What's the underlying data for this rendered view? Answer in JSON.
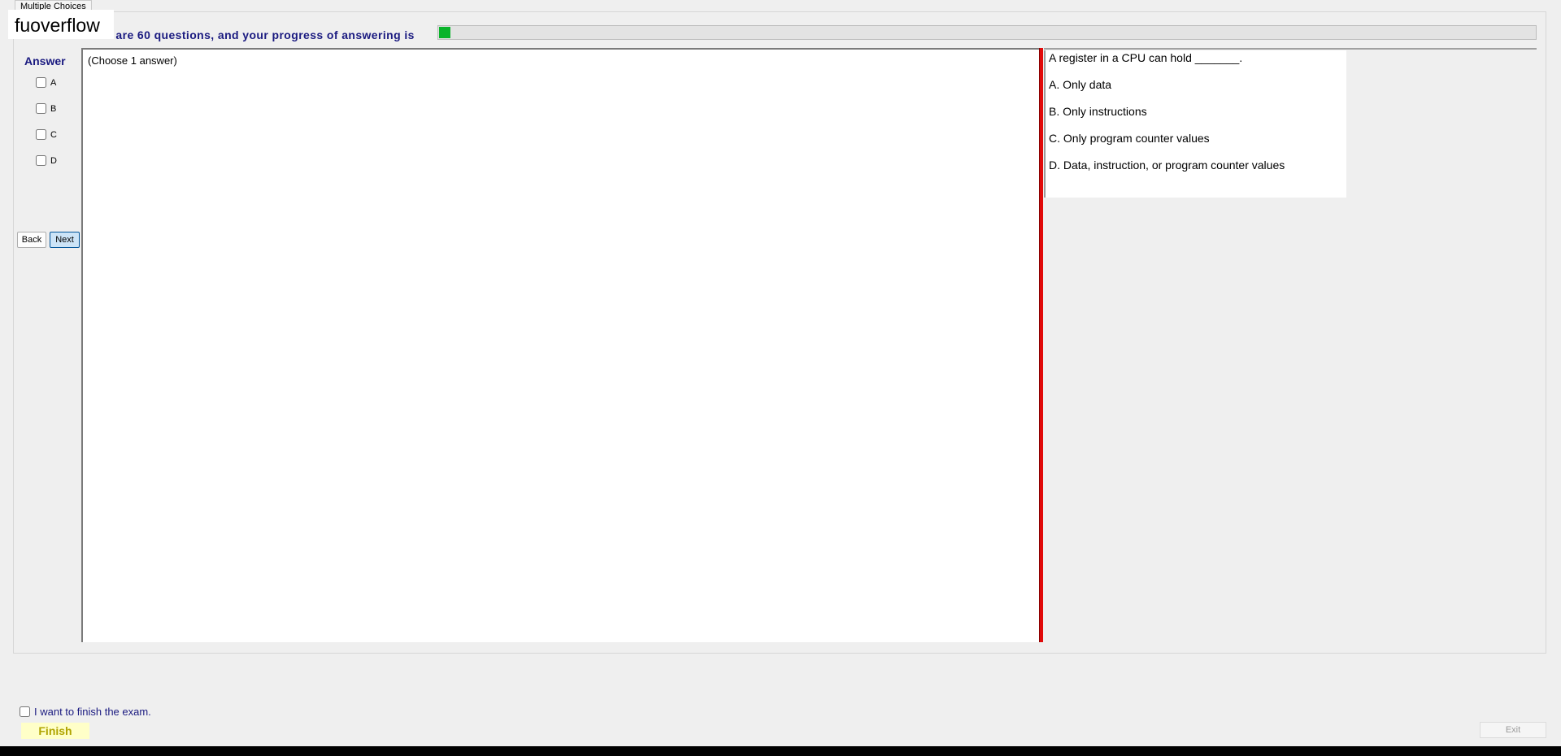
{
  "tab": {
    "label": "Multiple Choices"
  },
  "watermark": {
    "text": "fuoverflow"
  },
  "header": {
    "progress_text": "There are 60 questions, and your progress of answering is",
    "progress_percent": 1
  },
  "answer_panel": {
    "title": "Answer",
    "options": [
      {
        "label": "A",
        "checked": false
      },
      {
        "label": "B",
        "checked": false
      },
      {
        "label": "C",
        "checked": false
      },
      {
        "label": "D",
        "checked": false
      }
    ],
    "back_label": "Back",
    "next_label": "Next"
  },
  "content": {
    "instruction": "(Choose 1 answer)"
  },
  "question": {
    "text": "A register in a CPU can hold _______.",
    "choices": [
      "A.  Only data",
      "B.  Only instructions",
      "C.  Only program counter values",
      "D.  Data, instruction, or program counter values"
    ]
  },
  "footer": {
    "finish_checkbox_label": "I want to finish the exam.",
    "finish_label": "Finish",
    "exit_label": "Exit"
  },
  "colors": {
    "progress_fill": "#09b42a",
    "label_blue": "#1a1a80",
    "splitter_red": "#e10a0a",
    "finish_bg": "#ffffc8"
  }
}
